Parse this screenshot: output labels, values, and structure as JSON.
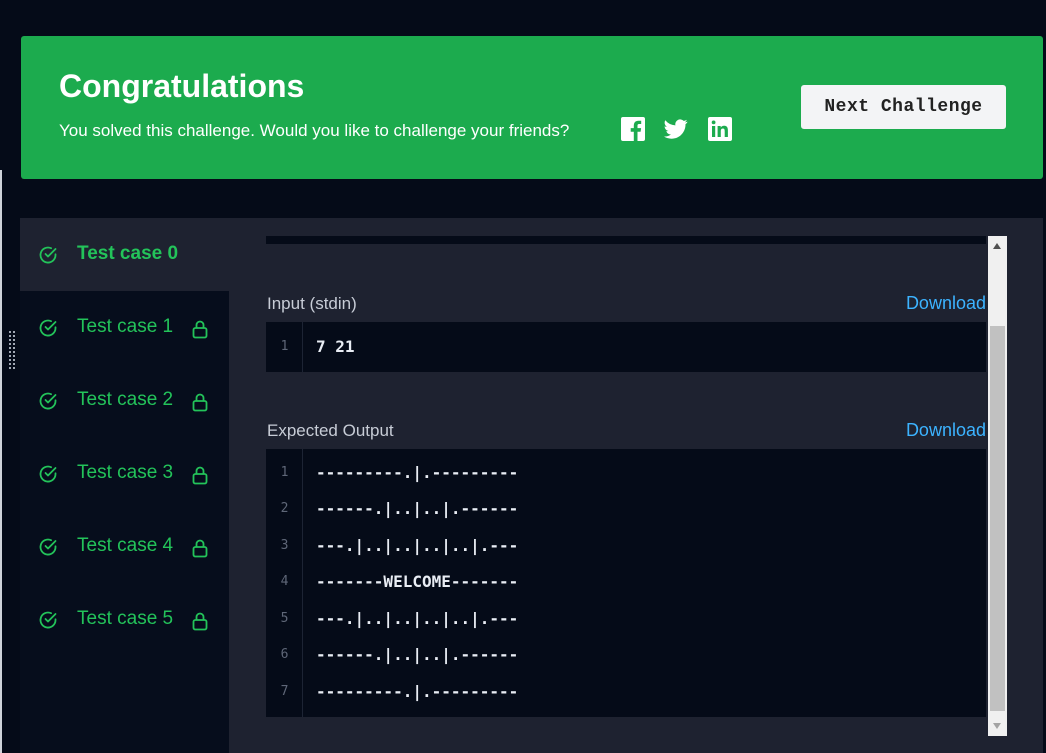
{
  "banner": {
    "title": "Congratulations",
    "message": "You solved this challenge. Would you like to challenge your friends?",
    "share_icons": [
      "facebook-icon",
      "twitter-icon",
      "linkedin-icon"
    ],
    "next_button": "Next Challenge",
    "background": "#1cab4e"
  },
  "tabs": [
    {
      "label": "Test case 0",
      "active": true,
      "locked": false
    },
    {
      "label": "Test case 1",
      "active": false,
      "locked": true
    },
    {
      "label": "Test case 2",
      "active": false,
      "locked": true
    },
    {
      "label": "Test case 3",
      "active": false,
      "locked": true
    },
    {
      "label": "Test case 4",
      "active": false,
      "locked": true
    },
    {
      "label": "Test case 5",
      "active": false,
      "locked": true
    }
  ],
  "input": {
    "label": "Input (stdin)",
    "download": "Download",
    "lines": [
      {
        "n": "1",
        "text": "7 21"
      }
    ]
  },
  "output": {
    "label": "Expected Output",
    "download": "Download",
    "lines": [
      {
        "n": "1",
        "text": "---------.|.---------"
      },
      {
        "n": "2",
        "text": "------.|..|..|.------"
      },
      {
        "n": "3",
        "text": "---.|..|..|..|..|.---"
      },
      {
        "n": "4",
        "text": "-------WELCOME-------"
      },
      {
        "n": "5",
        "text": "---.|..|..|..|..|.---"
      },
      {
        "n": "6",
        "text": "------.|..|..|.------"
      },
      {
        "n": "7",
        "text": "---------.|.---------"
      }
    ]
  },
  "colors": {
    "accent_green": "#23c35a",
    "link_blue": "#3cb3ff",
    "page_bg": "#050b18",
    "panel_bg": "#1e2230"
  }
}
